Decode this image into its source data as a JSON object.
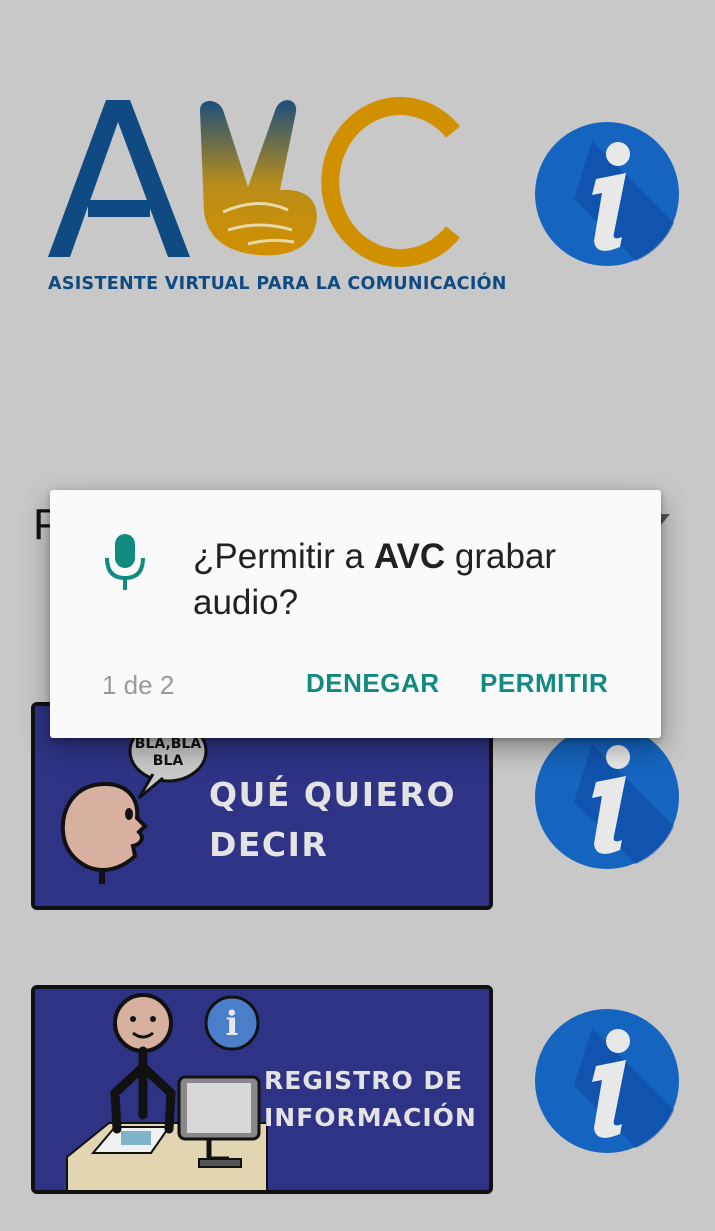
{
  "logo": {
    "letters": "AVC",
    "tagline": "ASISTENTE VIRTUAL PARA LA COMUNICACIÓN"
  },
  "background_partial_text": "P",
  "cards": [
    {
      "label": "QUÉ QUIERO\nDECIR",
      "speech_bubble": "BLA,BLA\nBLA"
    },
    {
      "label": "REGISTRO DE\nINFORMACIÓN",
      "badge": "i"
    }
  ],
  "info_icon_glyph": "i",
  "permission_dialog": {
    "icon": "microphone-icon",
    "message_prefix": "¿Permitir a ",
    "app_name": "AVC",
    "message_suffix": " grabar audio?",
    "counter": "1 de 2",
    "deny_label": "DENEGAR",
    "allow_label": "PERMITIR"
  },
  "colors": {
    "background": "#c8c8c8",
    "accent_teal": "#138a80",
    "logo_blue": "#0f4a82",
    "logo_gold": "#d19000",
    "card_blue": "#2e3386",
    "info_blue": "#1565c0"
  }
}
